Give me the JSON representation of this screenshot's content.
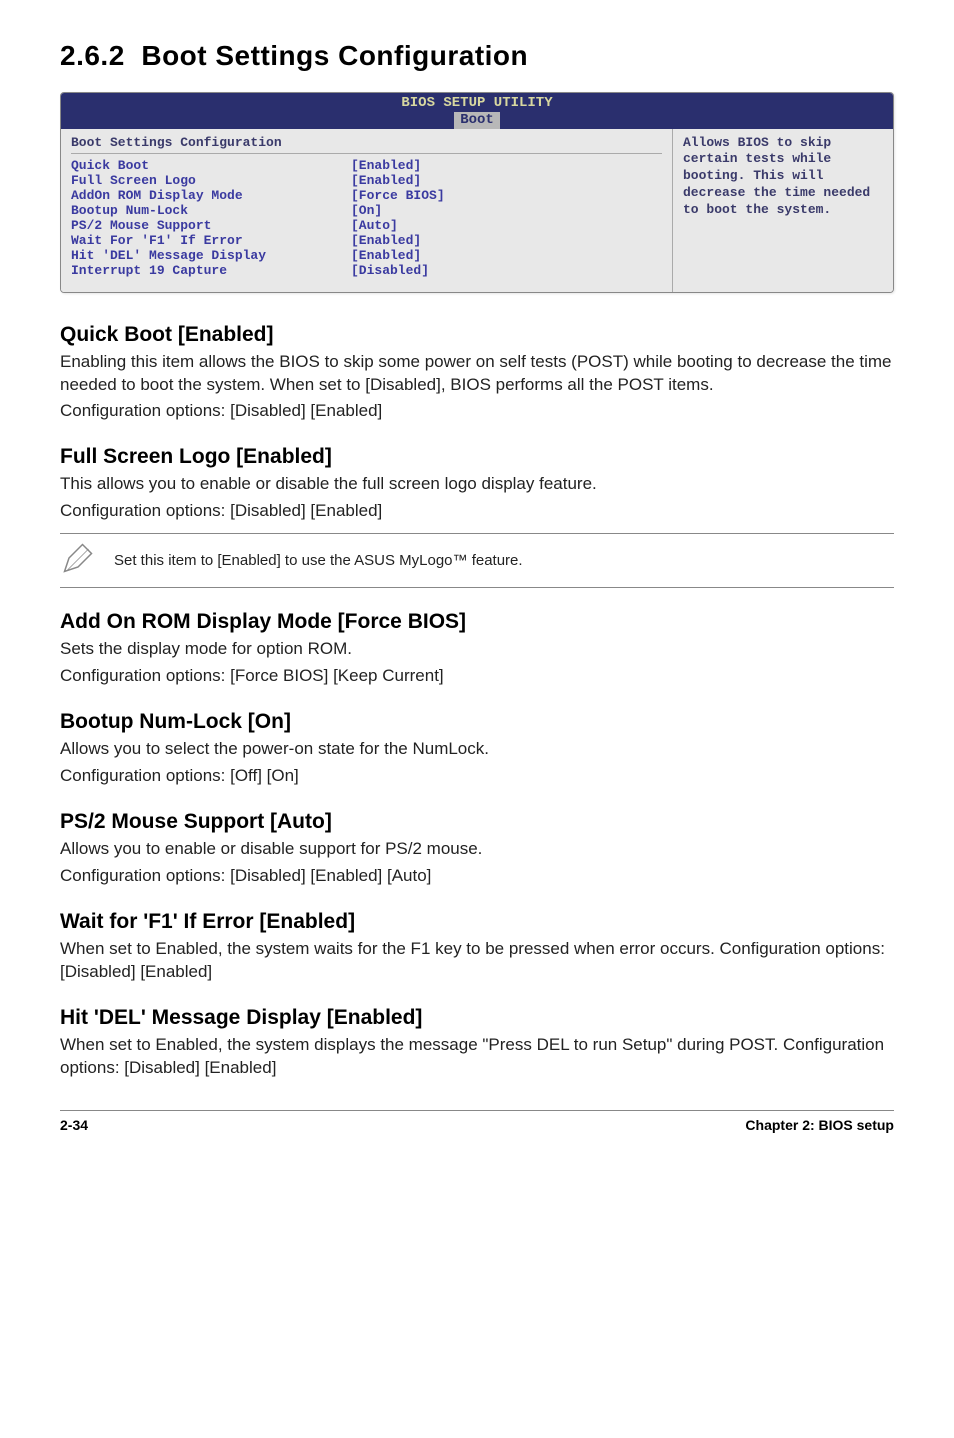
{
  "section": {
    "number": "2.6.2",
    "title": "Boot Settings Configuration"
  },
  "bios": {
    "header_title": "BIOS SETUP UTILITY",
    "tab": "Boot",
    "panel_title": "Boot Settings Configuration",
    "rows": [
      {
        "label": "Quick Boot",
        "value": "[Enabled]"
      },
      {
        "label": "Full Screen Logo",
        "value": "[Enabled]"
      },
      {
        "label": "AddOn ROM Display Mode",
        "value": "[Force BIOS]"
      },
      {
        "label": "Bootup Num-Lock",
        "value": "[On]"
      },
      {
        "label": "PS/2 Mouse Support",
        "value": "[Auto]"
      },
      {
        "label": "Wait For 'F1' If Error",
        "value": "[Enabled]"
      },
      {
        "label": "Hit 'DEL' Message Display",
        "value": "[Enabled]"
      },
      {
        "label": "Interrupt 19 Capture",
        "value": "[Disabled]"
      }
    ],
    "help": "Allows BIOS to skip certain tests while booting. This will decrease the time needed to boot the system."
  },
  "items": {
    "quick_boot": {
      "title": "Quick Boot [Enabled]",
      "desc": "Enabling this item allows the BIOS to skip some power on self tests (POST) while booting to decrease the time needed to boot the system. When set to [Disabled], BIOS performs all the POST items.",
      "opts": "Configuration options: [Disabled] [Enabled]"
    },
    "full_screen_logo": {
      "title": "Full Screen Logo [Enabled]",
      "desc": "This allows you to enable or disable the full screen logo display feature.",
      "opts": "Configuration options: [Disabled] [Enabled]"
    },
    "note": "Set this item to [Enabled] to use the ASUS MyLogo™ feature.",
    "addon_rom": {
      "title": "Add On ROM Display Mode [Force BIOS]",
      "desc": "Sets the display mode for option ROM.",
      "opts": "Configuration options: [Force BIOS] [Keep Current]"
    },
    "bootup_numlock": {
      "title": "Bootup Num-Lock [On]",
      "desc": "Allows you to select the power-on state for the NumLock.",
      "opts": "Configuration options: [Off] [On]"
    },
    "ps2_mouse": {
      "title": "PS/2 Mouse Support [Auto]",
      "desc": "Allows you to enable or disable support for PS/2 mouse.",
      "opts": "Configuration options: [Disabled] [Enabled] [Auto]"
    },
    "wait_f1": {
      "title": "Wait for 'F1' If Error [Enabled]",
      "desc": "When set to Enabled, the system waits for the F1 key to be pressed when error occurs. Configuration options: [Disabled] [Enabled]"
    },
    "hit_del": {
      "title": "Hit 'DEL' Message Display [Enabled]",
      "desc": "When set to Enabled, the system displays the message \"Press DEL to run Setup\" during POST. Configuration options: [Disabled] [Enabled]"
    }
  },
  "footer": {
    "page": "2-34",
    "chapter": "Chapter 2: BIOS setup"
  }
}
